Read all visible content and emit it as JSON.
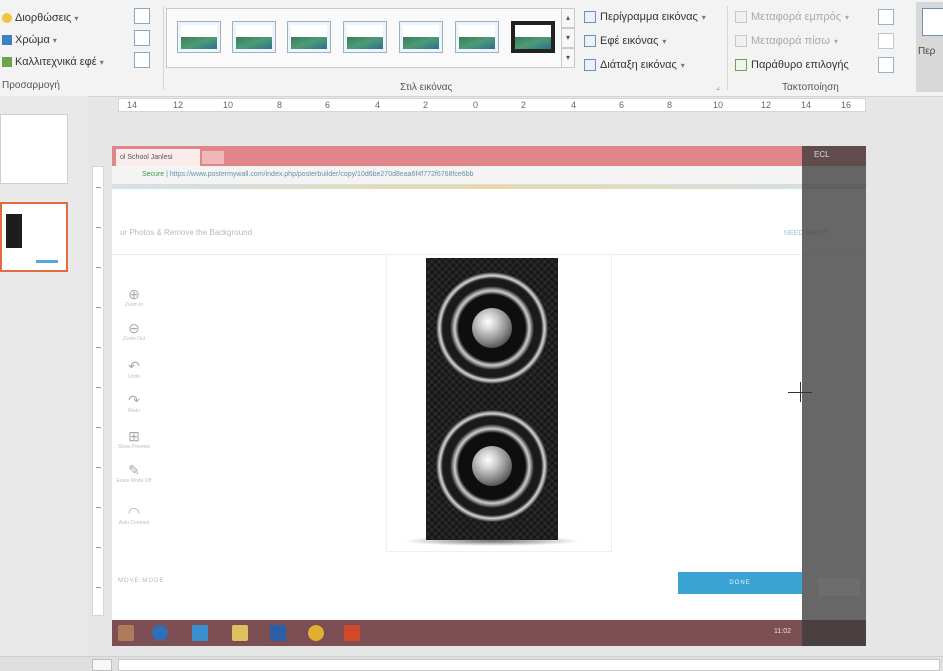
{
  "ribbon": {
    "adjust": {
      "items": [
        "Διορθώσεις",
        "Χρώμα",
        "Καλλιτεχνικά εφέ"
      ],
      "group_label": "Προσαρμογή"
    },
    "styles": {
      "group_label": "Στιλ εικόνας",
      "thumb_count": 7,
      "commands": [
        "Περίγραμμα εικόνας",
        "Εφέ εικόνας",
        "Διάταξη εικόνας"
      ]
    },
    "arrange": {
      "group_label": "Τακτοποίηση",
      "commands": [
        "Μεταφορά εμπρός",
        "Μεταφορά πίσω",
        "Παράθυρο επιλογής"
      ]
    },
    "big_button_label": "Περ"
  },
  "ruler": {
    "labels": [
      "14",
      "12",
      "10",
      "8",
      "6",
      "4",
      "2",
      "0",
      "2",
      "4",
      "6",
      "8",
      "10",
      "12",
      "14",
      "16"
    ]
  },
  "screenshot": {
    "tab_title": "ol School Janlesi",
    "address": {
      "secure_label": "Secure",
      "url": "https://www.postermywall.com/index.php/posterbuilder/copy/10d6be270d8eaa6f4f772f6768fce6bb"
    },
    "heading": "ur Photos & Remove the Background",
    "link": "NEED HELP?",
    "tools": [
      {
        "glyph": "⊕",
        "label": "Zoom In"
      },
      {
        "glyph": "⊖",
        "label": "Zoom Out"
      },
      {
        "glyph": "↶",
        "label": "Undo"
      },
      {
        "glyph": "↷",
        "label": "Redo"
      },
      {
        "glyph": "⊞",
        "label": "Show Preview"
      },
      {
        "glyph": "✎",
        "label": "Erase Mode Off"
      },
      {
        "glyph": "◠",
        "label": "Auto Contrast"
      }
    ],
    "mode_label": "MOVE MODE",
    "done_button": "DONE",
    "overlay_label": "ECL",
    "taskbar_time": "11:02"
  },
  "colors": {
    "browser_chrome": "#e0868a",
    "accent_blue": "#3aa3d4",
    "taskbar": "#7c4f55",
    "selected_slide_border": "#e06c40"
  }
}
